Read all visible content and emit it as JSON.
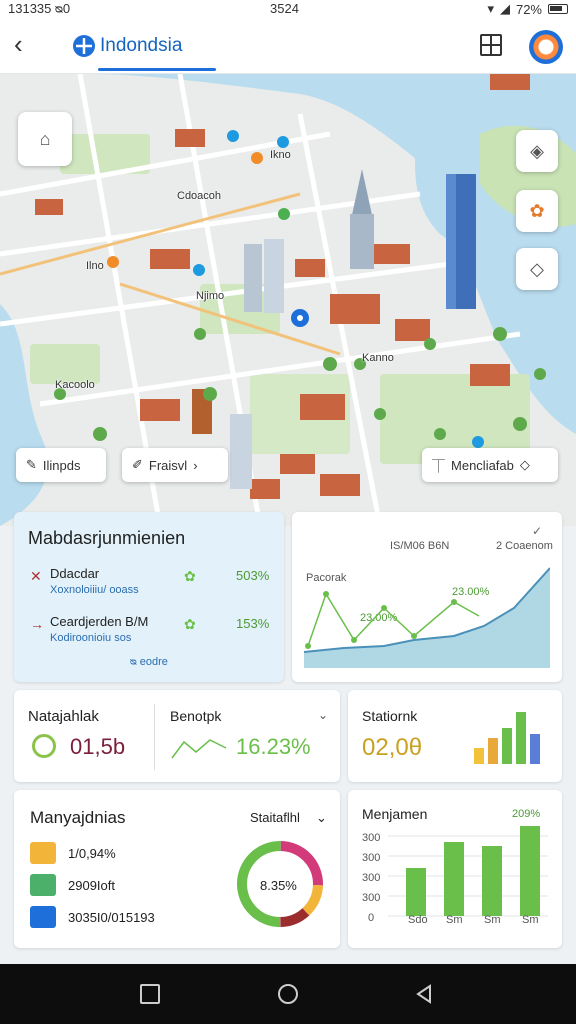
{
  "status_bar": {
    "left": "131335 ᴓ0",
    "time": "3524",
    "battery": "72%"
  },
  "header": {
    "title": "Indondsia"
  },
  "map": {
    "labels": [
      "Cdoacoh",
      "Ilno",
      "Njimo",
      "Kacoolo",
      "Kanno",
      "Ikno"
    ],
    "pills": {
      "left": "Ilinpds",
      "mid": "Fraisvl",
      "right": "Mencliafab"
    }
  },
  "summary_card": {
    "title": "Mabdasrjunmienien",
    "rows": [
      {
        "name": "Ddacdar",
        "sub": "Xoxnoloiiiu/ ooass",
        "value": "503%"
      },
      {
        "name": "Ceardjerden B/M",
        "sub": "Kodiroonioiu sos",
        "value": "153%"
      }
    ],
    "link": "ᴓ eodre"
  },
  "trend_card": {
    "header": "IS/M06 B6N",
    "header_right": "2 Coaenom",
    "label_left": "Pacorak",
    "label_mid": "23.00%",
    "label_mid2": "23.00%"
  },
  "stat1": {
    "label_a": "Natajahlak",
    "value_a": "01,5b",
    "label_b": "Benotpk",
    "value_b": "16.23%"
  },
  "stat2": {
    "label": "Statiornk",
    "value": "02,0θ"
  },
  "mgmt_card": {
    "title": "Manyajdnias",
    "dropdown": "Staitaflhl",
    "rows": [
      {
        "text": "1/0,94%"
      },
      {
        "text": "2909Ioft"
      },
      {
        "text": "3035I0/015193"
      }
    ],
    "donut_label": "8.35%"
  },
  "bar_card": {
    "title": "Menjamen",
    "top_label": "209%",
    "y_ticks": [
      "300",
      "300",
      "300",
      "300",
      "0"
    ],
    "x_ticks": [
      "Sdo",
      "Sm",
      "Sm",
      "Sm"
    ]
  },
  "colors": {
    "accent": "#1e6fd9",
    "green": "#6abf4b",
    "water": "#b9dcef"
  }
}
